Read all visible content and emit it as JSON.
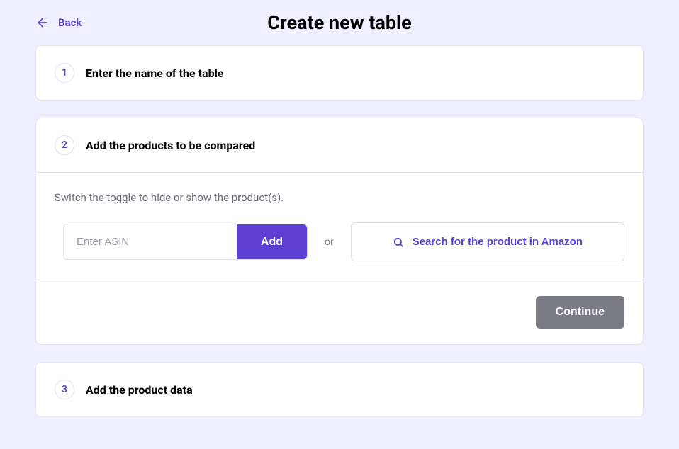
{
  "header": {
    "back_label": "Back",
    "title": "Create new table"
  },
  "steps": {
    "s1": {
      "number": "1",
      "title": "Enter the name of the table"
    },
    "s2": {
      "number": "2",
      "title": "Add the products to be compared",
      "hint": "Switch the toggle to hide or show the product(s).",
      "asin_placeholder": "Enter ASIN",
      "add_label": "Add",
      "or_label": "or",
      "search_label": "Search for the product in Amazon",
      "continue_label": "Continue"
    },
    "s3": {
      "number": "3",
      "title": "Add the product data"
    }
  }
}
